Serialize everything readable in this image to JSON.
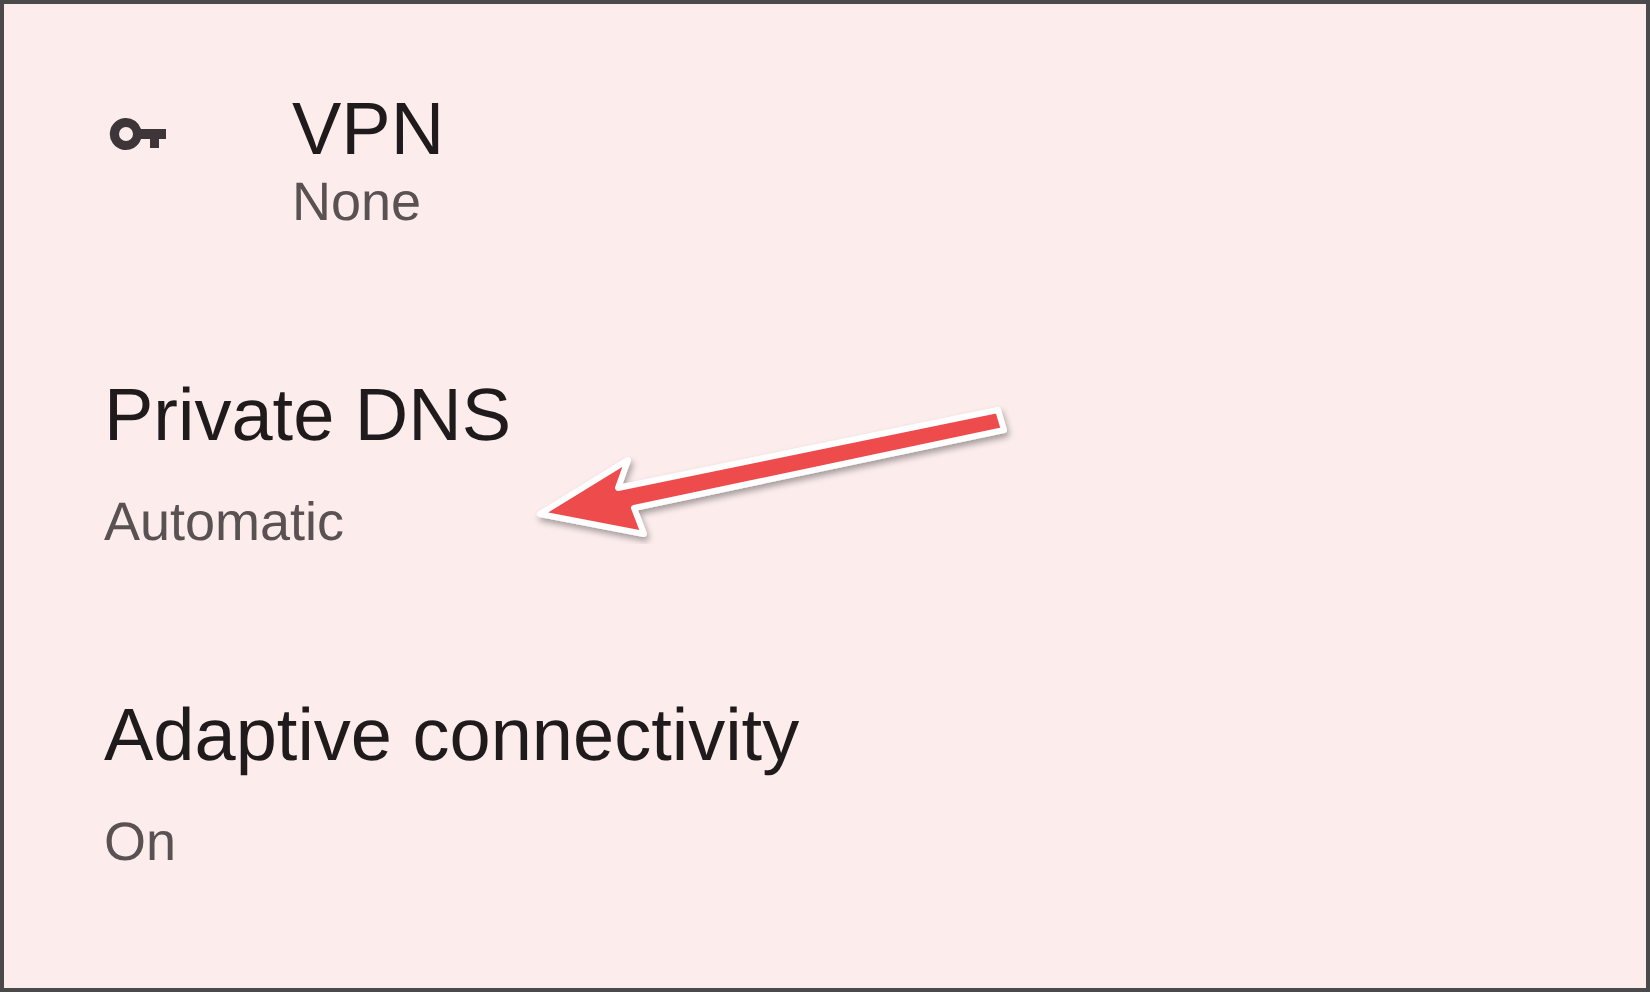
{
  "settings": [
    {
      "kind": "icon",
      "title": "VPN",
      "summary": "None"
    },
    {
      "kind": "plain",
      "title": "Private DNS",
      "summary": "Automatic"
    },
    {
      "kind": "plain",
      "title": "Adaptive connectivity",
      "summary": "On"
    }
  ]
}
